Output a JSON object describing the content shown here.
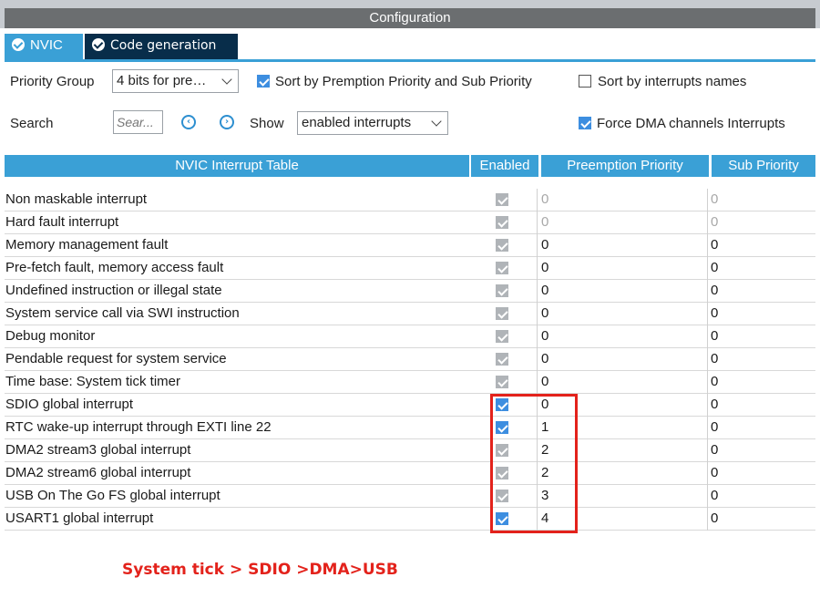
{
  "window": {
    "title": "Configuration"
  },
  "tabs": [
    {
      "label": "NVIC",
      "active": true
    },
    {
      "label": "Code generation",
      "active": false
    }
  ],
  "controls": {
    "priority_group_label": "Priority Group",
    "priority_group_value": "4 bits for pre…",
    "sort_premption_label": "Sort by Premption Priority and Sub Priority",
    "sort_premption_checked": true,
    "sort_names_label": "Sort by interrupts names",
    "sort_names_checked": false,
    "search_label": "Search",
    "search_placeholder": "Sear...",
    "show_label": "Show",
    "show_value": "enabled interrupts",
    "force_dma_label": "Force DMA channels Interrupts",
    "force_dma_checked": true
  },
  "table": {
    "headers": [
      "NVIC Interrupt Table",
      "Enabled",
      "Preemption Priority",
      "Sub Priority"
    ],
    "rows": [
      {
        "name": "Non maskable interrupt",
        "enabled": true,
        "editable": false,
        "preemption": "0",
        "sub": "0",
        "muted": true
      },
      {
        "name": "Hard fault interrupt",
        "enabled": true,
        "editable": false,
        "preemption": "0",
        "sub": "0",
        "muted": true
      },
      {
        "name": "Memory management fault",
        "enabled": true,
        "editable": false,
        "preemption": "0",
        "sub": "0",
        "muted": false
      },
      {
        "name": "Pre-fetch fault, memory access fault",
        "enabled": true,
        "editable": false,
        "preemption": "0",
        "sub": "0",
        "muted": false
      },
      {
        "name": "Undefined instruction or illegal state",
        "enabled": true,
        "editable": false,
        "preemption": "0",
        "sub": "0",
        "muted": false
      },
      {
        "name": "System service call via SWI instruction",
        "enabled": true,
        "editable": false,
        "preemption": "0",
        "sub": "0",
        "muted": false
      },
      {
        "name": "Debug monitor",
        "enabled": true,
        "editable": false,
        "preemption": "0",
        "sub": "0",
        "muted": false
      },
      {
        "name": "Pendable request for system service",
        "enabled": true,
        "editable": false,
        "preemption": "0",
        "sub": "0",
        "muted": false
      },
      {
        "name": "Time base: System tick timer",
        "enabled": true,
        "editable": false,
        "preemption": "0",
        "sub": "0",
        "muted": false
      },
      {
        "name": "SDIO global interrupt",
        "enabled": true,
        "editable": true,
        "preemption": "0",
        "sub": "0",
        "muted": false
      },
      {
        "name": "RTC wake-up interrupt through EXTI line 22",
        "enabled": true,
        "editable": true,
        "preemption": "1",
        "sub": "0",
        "muted": false
      },
      {
        "name": "DMA2 stream3 global interrupt",
        "enabled": true,
        "editable": false,
        "preemption": "2",
        "sub": "0",
        "muted": false
      },
      {
        "name": "DMA2 stream6 global interrupt",
        "enabled": true,
        "editable": false,
        "preemption": "2",
        "sub": "0",
        "muted": false
      },
      {
        "name": "USB On The Go FS global interrupt",
        "enabled": true,
        "editable": false,
        "preemption": "3",
        "sub": "0",
        "muted": false
      },
      {
        "name": "USART1 global interrupt",
        "enabled": true,
        "editable": true,
        "preemption": "4",
        "sub": "0",
        "muted": false
      }
    ]
  },
  "annotation": {
    "note": "System tick > SDIO >DMA>USB"
  },
  "colors": {
    "accent": "#3aa0d6",
    "tab_dark": "#082d4a",
    "annotation_red": "#e3221b"
  }
}
